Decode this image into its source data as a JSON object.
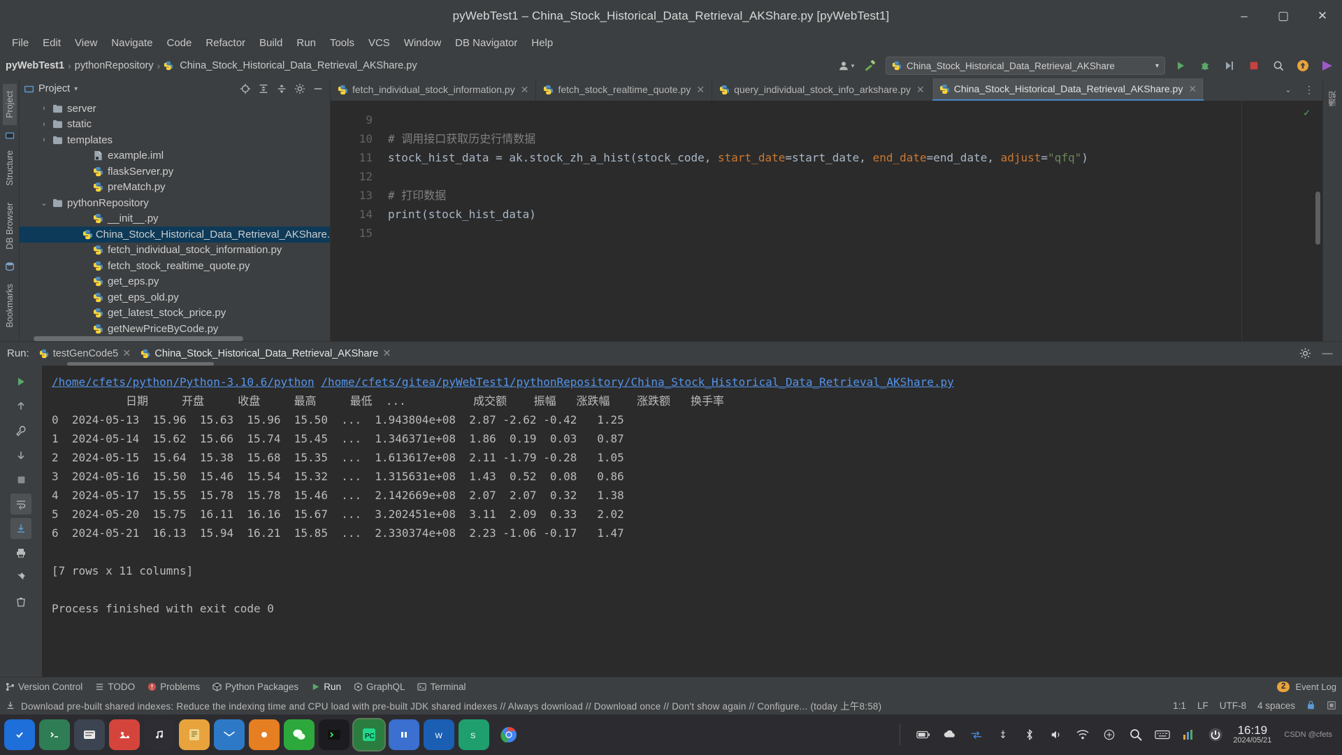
{
  "window": {
    "title": "pyWebTest1 – China_Stock_Historical_Data_Retrieval_AKShare.py [pyWebTest1]",
    "minimize": "–",
    "maximize": "▢",
    "close": "✕"
  },
  "menubar": {
    "items": [
      "File",
      "Edit",
      "View",
      "Navigate",
      "Code",
      "Refactor",
      "Build",
      "Run",
      "Tools",
      "VCS",
      "Window",
      "DB Navigator",
      "Help"
    ]
  },
  "breadcrumb": {
    "project": "pyWebTest1",
    "folder": "pythonRepository",
    "file": "China_Stock_Historical_Data_Retrieval_AKShare.py",
    "sep": "›"
  },
  "runconfig": {
    "name": "China_Stock_Historical_Data_Retrieval_AKShare",
    "chevron": "▾",
    "run_icon": "▶",
    "debug_icon": "🐞",
    "coverage_icon": "▶|",
    "stop_icon": "■",
    "search_icon": "🔍",
    "update_icon": "↑",
    "ide_icon": "▶"
  },
  "left_rail": {
    "tabs": [
      "Project",
      "Structure",
      "DB Browser"
    ],
    "selected": "Project",
    "bookmarks": "Bookmarks"
  },
  "project_panel": {
    "title": "Project",
    "chevron": "▾",
    "tools": [
      "target-icon",
      "collapse-all-icon",
      "expand-all-icon",
      "settings-icon",
      "hide-icon"
    ],
    "tree": [
      {
        "label": "server",
        "type": "folder",
        "indent": 1,
        "arrow": "›",
        "selected": false
      },
      {
        "label": "static",
        "type": "folder",
        "indent": 1,
        "arrow": "›",
        "selected": false
      },
      {
        "label": "templates",
        "type": "folder",
        "indent": 1,
        "arrow": "›",
        "selected": false
      },
      {
        "label": "example.iml",
        "type": "iml",
        "indent": 2,
        "arrow": "",
        "selected": false
      },
      {
        "label": "flaskServer.py",
        "type": "py",
        "indent": 2,
        "arrow": "",
        "selected": false
      },
      {
        "label": "preMatch.py",
        "type": "py",
        "indent": 2,
        "arrow": "",
        "selected": false
      },
      {
        "label": "pythonRepository",
        "type": "folder",
        "indent": 1,
        "arrow": "⌄",
        "selected": false
      },
      {
        "label": "__init__.py",
        "type": "py",
        "indent": 2,
        "arrow": "",
        "selected": false
      },
      {
        "label": "China_Stock_Historical_Data_Retrieval_AKShare.",
        "type": "py",
        "indent": 2,
        "arrow": "",
        "selected": true
      },
      {
        "label": "fetch_individual_stock_information.py",
        "type": "py",
        "indent": 2,
        "arrow": "",
        "selected": false
      },
      {
        "label": "fetch_stock_realtime_quote.py",
        "type": "py",
        "indent": 2,
        "arrow": "",
        "selected": false
      },
      {
        "label": "get_eps.py",
        "type": "py",
        "indent": 2,
        "arrow": "",
        "selected": false
      },
      {
        "label": "get_eps_old.py",
        "type": "py",
        "indent": 2,
        "arrow": "",
        "selected": false
      },
      {
        "label": "get_latest_stock_price.py",
        "type": "py",
        "indent": 2,
        "arrow": "",
        "selected": false
      },
      {
        "label": "getNewPriceByCode.py",
        "type": "py",
        "indent": 2,
        "arrow": "",
        "selected": false
      }
    ]
  },
  "editor": {
    "tabs": [
      {
        "label": "fetch_individual_stock_information.py",
        "active": false,
        "close": "✕"
      },
      {
        "label": "fetch_stock_realtime_quote.py",
        "active": false,
        "close": "✕"
      },
      {
        "label": "query_individual_stock_info_arkshare.py",
        "active": false,
        "close": "✕"
      },
      {
        "label": "China_Stock_Historical_Data_Retrieval_AKShare.py",
        "active": true,
        "close": "✕"
      }
    ],
    "tab_overflow": "⌄",
    "tab_menu": "⋮",
    "inspection_ok": "✓",
    "line_numbers": [
      "9",
      "10",
      "11",
      "12",
      "13",
      "14",
      "15"
    ],
    "lines": [
      {
        "n": "9",
        "segments": []
      },
      {
        "n": "10",
        "segments": [
          {
            "t": "# 调用接口获取历史行情数据",
            "c": "cm"
          }
        ]
      },
      {
        "n": "11",
        "segments": [
          {
            "t": "stock_hist_data = ak.stock_zh_a_hist(stock_code, ",
            "c": "id"
          },
          {
            "t": "start_date",
            "c": "named"
          },
          {
            "t": "=start_date, ",
            "c": "id"
          },
          {
            "t": "end_date",
            "c": "named"
          },
          {
            "t": "=end_date, ",
            "c": "id"
          },
          {
            "t": "adjust",
            "c": "named"
          },
          {
            "t": "=",
            "c": "id"
          },
          {
            "t": "\"qfq\"",
            "c": "st"
          },
          {
            "t": ")",
            "c": "id"
          }
        ]
      },
      {
        "n": "12",
        "segments": []
      },
      {
        "n": "13",
        "segments": [
          {
            "t": "# 打印数据",
            "c": "cm"
          }
        ]
      },
      {
        "n": "14",
        "segments": [
          {
            "t": "print(stock_hist_data)",
            "c": "id"
          }
        ]
      },
      {
        "n": "15",
        "segments": []
      }
    ]
  },
  "run_panel": {
    "label": "Run:",
    "tabs": [
      {
        "label": "testGenCode5",
        "active": false,
        "close": "✕"
      },
      {
        "label": "China_Stock_Historical_Data_Retrieval_AKShare",
        "active": true,
        "close": "✕"
      }
    ],
    "settings_icon": "⚙",
    "hide_icon": "—",
    "toolbar": [
      "run-icon",
      "up-icon",
      "wrench-icon",
      "down-icon",
      "stop-icon",
      "soft-wrap-icon",
      "scroll-end-icon",
      "print-icon",
      "pin-icon",
      "trash-icon"
    ],
    "command_python": "/home/cfets/python/Python-3.10.6/python",
    "command_script": "/home/cfets/gitea/pyWebTest1/pythonRepository/China_Stock_Historical_Data_Retrieval_AKShare.py",
    "table_header": "           日期     开盘     收盘     最高     最低  ...          成交额    振幅   涨跌幅    涨跌额   换手率",
    "table_rows": [
      "0  2024-05-13  15.96  15.63  15.96  15.50  ...  1.943804e+08  2.87 -2.62 -0.42   1.25",
      "1  2024-05-14  15.62  15.66  15.74  15.45  ...  1.346371e+08  1.86  0.19  0.03   0.87",
      "2  2024-05-15  15.64  15.38  15.68  15.35  ...  1.613617e+08  2.11 -1.79 -0.28   1.05",
      "3  2024-05-16  15.50  15.46  15.54  15.32  ...  1.315631e+08  1.43  0.52  0.08   0.86",
      "4  2024-05-17  15.55  15.78  15.78  15.46  ...  2.142669e+08  2.07  2.07  0.32   1.38",
      "5  2024-05-20  15.75  16.11  16.16  15.67  ...  3.202451e+08  3.11  2.09  0.33   2.02",
      "6  2024-05-21  16.13  15.94  16.21  15.85  ...  2.330374e+08  2.23 -1.06 -0.17   1.47"
    ],
    "summary": "[7 rows x 11 columns]",
    "exit_message": "Process finished with exit code 0"
  },
  "bottom_toolwindows": {
    "items": [
      {
        "label": "Version Control",
        "icon": "branch-icon",
        "active": false
      },
      {
        "label": "TODO",
        "icon": "list-icon",
        "active": false
      },
      {
        "label": "Problems",
        "icon": "error-icon",
        "active": false
      },
      {
        "label": "Python Packages",
        "icon": "package-icon",
        "active": false
      },
      {
        "label": "Run",
        "icon": "play-icon",
        "active": true
      },
      {
        "label": "GraphQL",
        "icon": "graphql-icon",
        "active": false
      },
      {
        "label": "Terminal",
        "icon": "terminal-icon",
        "active": false
      }
    ],
    "event_count": "2",
    "event_log": "Event Log"
  },
  "statusbar": {
    "message": "Download pre-built shared indexes: Reduce the indexing time and CPU load with pre-built JDK shared indexes // Always download // Download once // Don't show again // Configure... (today 上午8:58)",
    "caret": "1:1",
    "line_ending": "LF",
    "encoding": "UTF-8",
    "indent": "4 spaces",
    "lock_icon": "🔒"
  },
  "taskbar": {
    "icons": [
      "start-icon",
      "terminal-icon",
      "files-icon",
      "photos-icon",
      "music-icon",
      "notes-icon",
      "mail-icon",
      "browser-icon",
      "wechat-icon",
      "shell-icon",
      "pycharm-icon",
      "ide-icon",
      "word-icon",
      "stock-icon",
      "chrome-icon"
    ],
    "tray": [
      "battery-icon",
      "cloud-icon",
      "network-icon",
      "usb-icon",
      "bluetooth-icon",
      "volume-icon",
      "wifi-icon",
      "input-icon",
      "search-icon",
      "keyboard-icon",
      "chart-icon",
      "power-icon"
    ],
    "time": "16:19",
    "date": "2024/05/21",
    "watermark": "CSDN @cfets"
  }
}
